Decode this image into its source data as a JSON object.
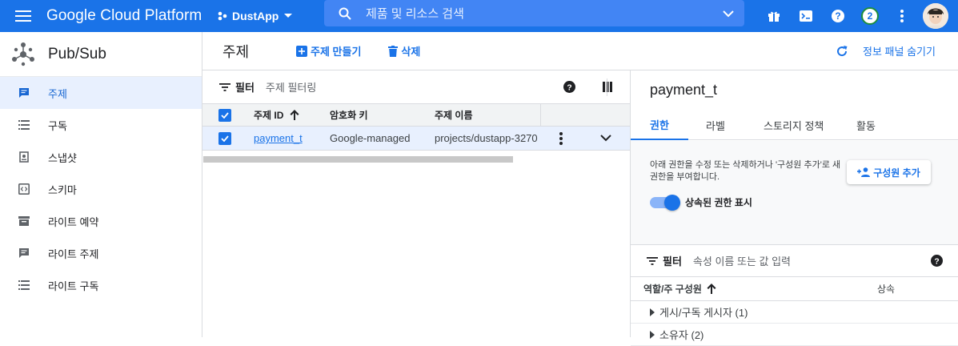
{
  "topbar": {
    "brand": "Google Cloud Platform",
    "project": "DustApp",
    "search_placeholder": "제품 및 리소스 검색",
    "notification_count": "2"
  },
  "sidebar": {
    "product": "Pub/Sub",
    "items": [
      {
        "label": "주제",
        "icon": "message-icon",
        "active": true
      },
      {
        "label": "구독",
        "icon": "list-icon",
        "active": false
      },
      {
        "label": "스냅샷",
        "icon": "snapshot-icon",
        "active": false
      },
      {
        "label": "스키마",
        "icon": "code-icon",
        "active": false
      },
      {
        "label": "라이트 예약",
        "icon": "reservation-icon",
        "active": false
      },
      {
        "label": "라이트 주제",
        "icon": "message-icon",
        "active": false
      },
      {
        "label": "라이트 구독",
        "icon": "list-icon",
        "active": false
      }
    ]
  },
  "toolbar": {
    "title": "주제",
    "create_label": "주제 만들기",
    "delete_label": "삭제",
    "hide_panel_label": "정보 패널 숨기기"
  },
  "topics": {
    "filter_label": "필터",
    "filter_placeholder": "주제 필터링",
    "columns": [
      "주제 ID",
      "암호화 키",
      "주제 이름"
    ],
    "rows": [
      {
        "id": "payment_t",
        "encryption": "Google-managed",
        "name": "projects/dustapp-3270"
      }
    ]
  },
  "info_panel": {
    "title": "payment_t",
    "tabs": [
      "권한",
      "라벨",
      "스토리지 정책",
      "활동"
    ],
    "description": "아래 권한을 수정 또는 삭제하거나 '구성원 추가'로 새 권한을 부여합니다.",
    "add_member_label": "구성원 추가",
    "inherited_toggle_label": "상속된 권한 표시",
    "filter_label": "필터",
    "filter_placeholder": "속성 이름 또는 값 입력",
    "columns": [
      "역할/주 구성원",
      "상속"
    ],
    "roles": [
      "게시/구독 게시자 (1)",
      "소유자 (2)"
    ]
  }
}
